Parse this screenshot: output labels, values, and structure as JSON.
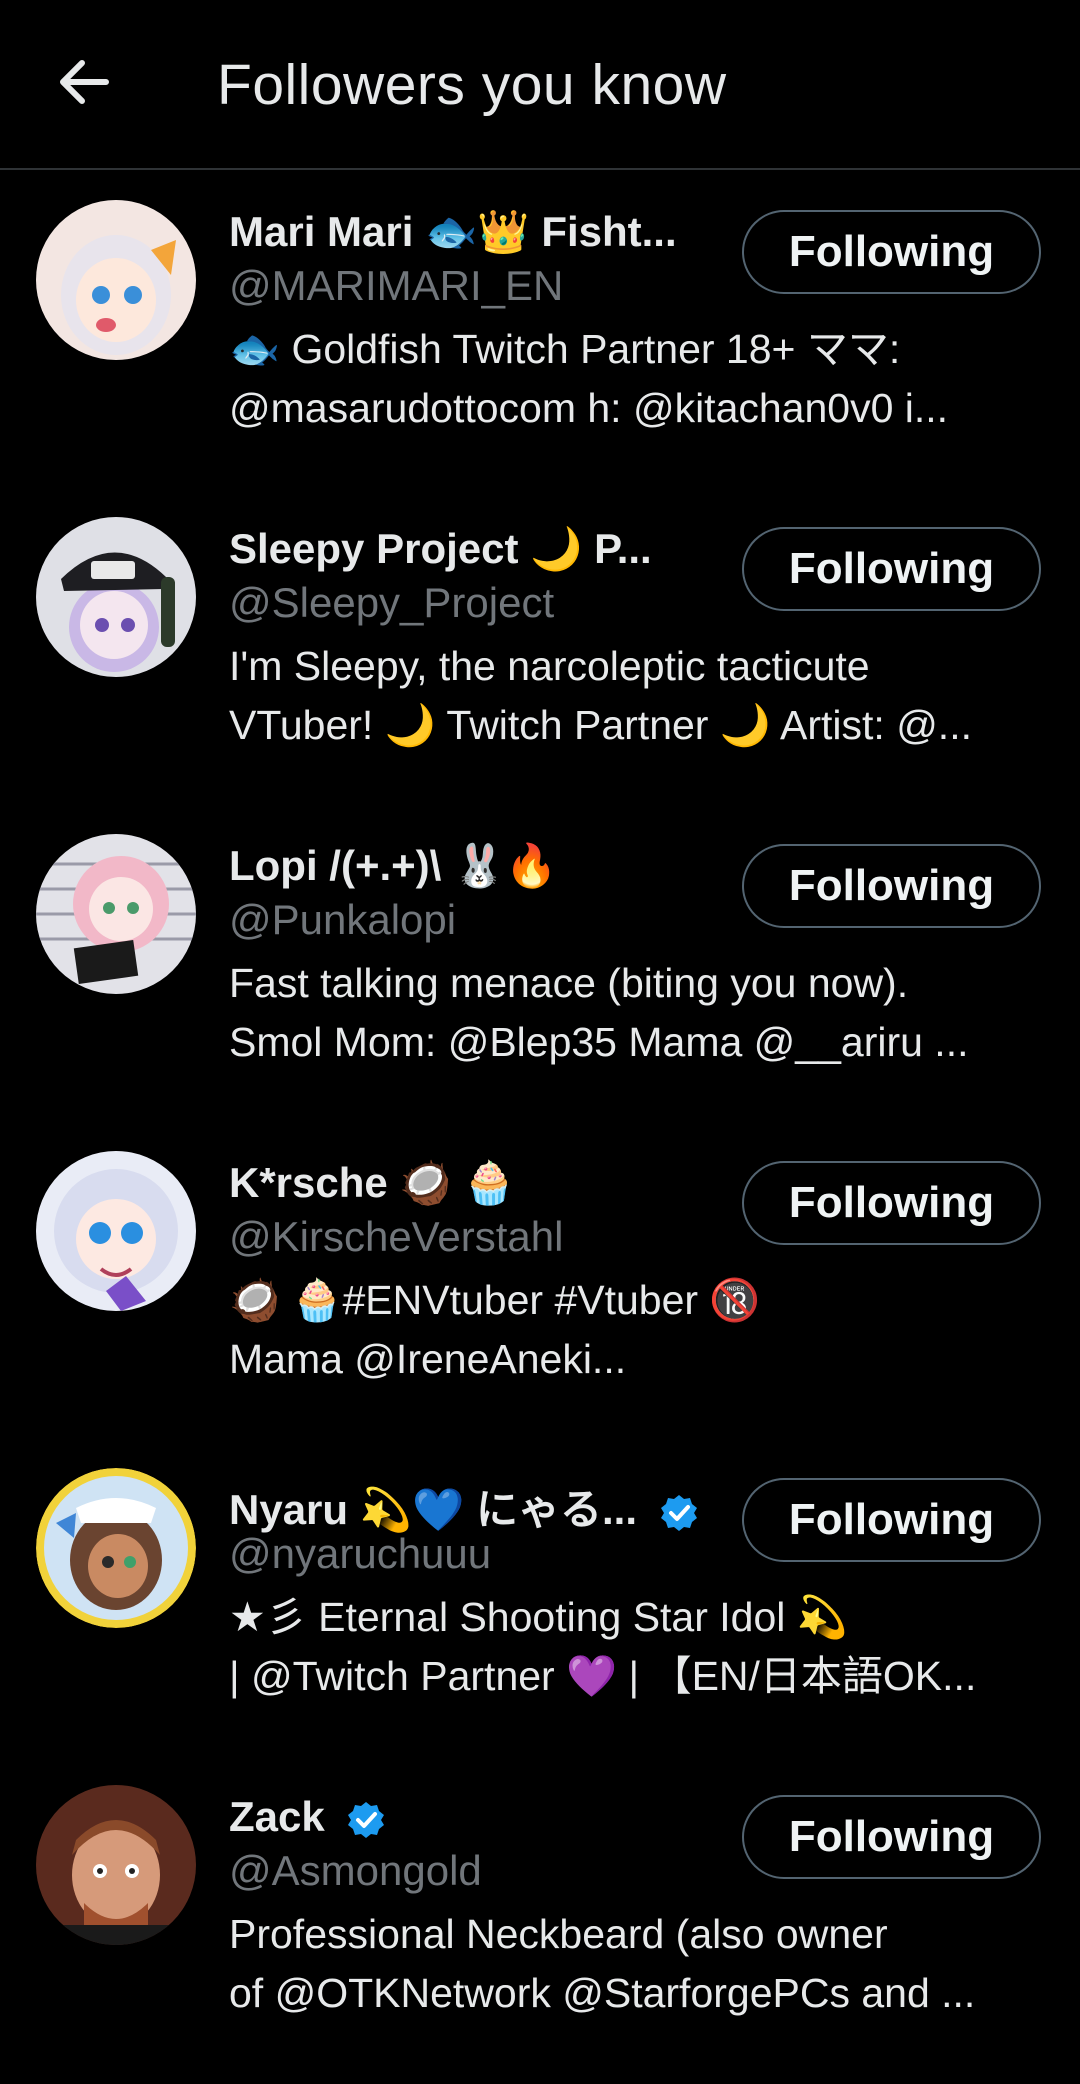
{
  "header": {
    "title": "Followers you know",
    "back_icon": "arrow-left-icon"
  },
  "colors": {
    "background": "#000000",
    "text_primary": "#e7e9ea",
    "text_secondary": "#71767b",
    "divider": "#2f3336",
    "button_border": "#536471",
    "verified_blue": "#1d9bf0"
  },
  "users": [
    {
      "name": "Mari Mari 🐟👑 Fisht...",
      "handle": "@MARIMARI_EN",
      "verified": false,
      "bio_line1": "🐟 Goldfish Twitch Partner 18+ ママ:",
      "bio_line2": "@masarudottocom h: @kitachan0v0 i...",
      "button": "Following"
    },
    {
      "name": "Sleepy Project 🌙 P...",
      "handle": "@Sleepy_Project",
      "verified": false,
      "bio_line1": "I'm Sleepy, the narcoleptic tacticute",
      "bio_line2": "VTuber! 🌙 Twitch Partner 🌙 Artist: @...",
      "button": "Following"
    },
    {
      "name": "Lopi /(+.+)\\ 🐰🔥",
      "handle": "@Punkalopi",
      "verified": false,
      "bio_line1": "Fast talking menace (biting you now).",
      "bio_line2": "Smol Mom: @Blep35 Mama @__ariru ...",
      "button": "Following"
    },
    {
      "name": "K*rsche 🥥 🧁",
      "handle": "@KirscheVerstahl",
      "verified": false,
      "bio_line1": "🥥 🧁#ENVtuber #Vtuber 🔞",
      "bio_line2": "Mama @IreneAneki...",
      "button": "Following"
    },
    {
      "name": "Nyaru 💫💙 にゃる...",
      "handle": "@nyaruchuuu",
      "verified": true,
      "bio_line1": "★彡 Eternal Shooting Star Idol 💫",
      "bio_line2": "| @Twitch Partner 💜 | 【EN/日本語OK...",
      "button": "Following"
    },
    {
      "name": "Zack",
      "handle": "@Asmongold",
      "verified": true,
      "bio_line1": "Professional Neckbeard (also owner",
      "bio_line2": "of @OTKNetwork @StarforgePCs and ...",
      "button": "Following"
    }
  ]
}
